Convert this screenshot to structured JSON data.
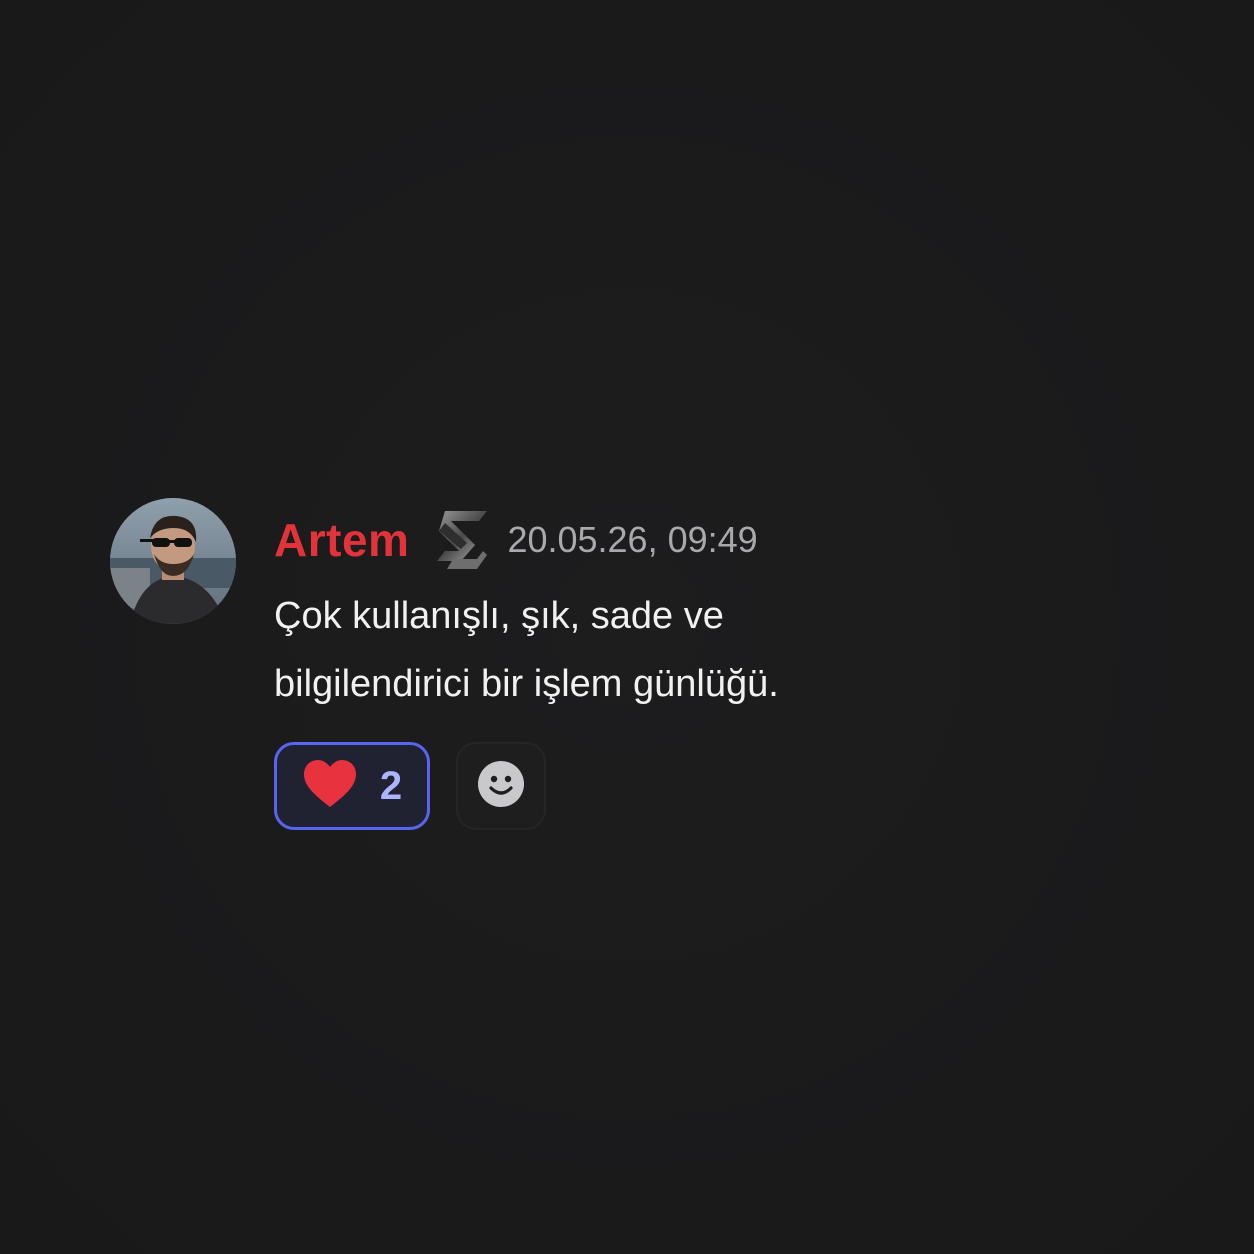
{
  "message": {
    "author": "Artem",
    "timestamp": "20.05.26, 09:49",
    "body_line1": "Çok kullanışlı, şık, sade ve",
    "body_line2": "bilgilendirici bir işlem günlüğü.",
    "author_color": "#e2333b",
    "badge_icon": "s-logo-icon",
    "avatar": "user-avatar"
  },
  "reactions": [
    {
      "emoji": "heart-icon",
      "count": "2",
      "selected": true
    }
  ],
  "add_reaction_icon": "smiley-face-icon",
  "colors": {
    "background": "#1b1b1c",
    "accent": "#5865f2",
    "count_text": "#aab4ff",
    "heart": "#e8323d"
  }
}
